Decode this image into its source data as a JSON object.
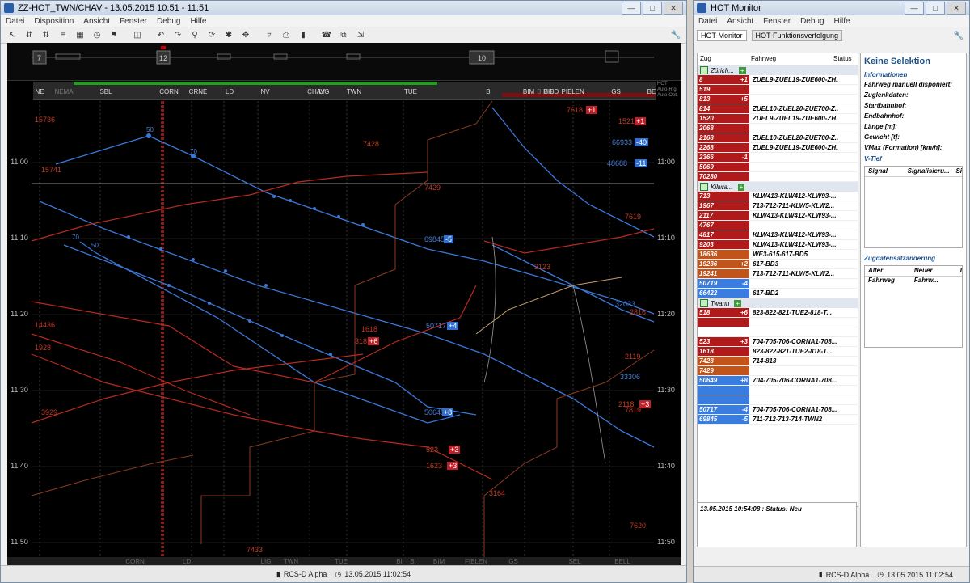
{
  "left_window": {
    "title": "ZZ-HOT_TWN/CHAV - 13.05.2015 10:51 - 11:51",
    "menu": [
      "Datei",
      "Disposition",
      "Ansicht",
      "Fenster",
      "Debug",
      "Hilfe"
    ],
    "overview_numbers": [
      "7",
      "12",
      "10"
    ],
    "stations_top": [
      "NE",
      "NEMA",
      "SBL",
      "CORN",
      "CRNE",
      "LD",
      "NV",
      "CHAV",
      "LIG",
      "TWN",
      "TUE",
      "BI",
      "BIMA",
      "BIM",
      "BIBD",
      "PIE",
      "LEN",
      "GS",
      "BE"
    ],
    "side_labels": [
      "HOT",
      "Auto-Rfg.",
      "Auto-Opt."
    ],
    "time_ticks": [
      "11:00",
      "11:10",
      "11:20",
      "11:30",
      "11:40",
      "11:50"
    ],
    "stations_bottom": [
      "CORN",
      "LD",
      "LIG",
      "TWN",
      "TUE",
      "BI",
      "BI",
      "BIM",
      "FIBLEN",
      "GS",
      "SEL",
      "BELL"
    ],
    "train_labels": [
      {
        "text": "15736",
        "color": "#c23b22"
      },
      {
        "text": "15741",
        "color": "#c23b22"
      },
      {
        "text": "7428",
        "color": "#c23b22"
      },
      {
        "text": "7429",
        "color": "#c23b22"
      },
      {
        "text": "7618",
        "color": "#c23b22"
      },
      {
        "text": "1521",
        "color": "#c23b22"
      },
      {
        "text": "66933",
        "color": "#4a7fd6"
      },
      {
        "text": "48688",
        "color": "#4a7fd6"
      },
      {
        "text": "7619",
        "color": "#c23b22"
      },
      {
        "text": "69845",
        "color": "#4a7fd6"
      },
      {
        "text": "3123",
        "color": "#c23b22"
      },
      {
        "text": "14436",
        "color": "#c23b22"
      },
      {
        "text": "1928",
        "color": "#c23b22"
      },
      {
        "text": "1618",
        "color": "#c23b22"
      },
      {
        "text": "318",
        "color": "#c23b22"
      },
      {
        "text": "50717",
        "color": "#4a7fd6"
      },
      {
        "text": "32033",
        "color": "#4a7fd6"
      },
      {
        "text": "2816",
        "color": "#c23b22"
      },
      {
        "text": "2119",
        "color": "#c23b22"
      },
      {
        "text": "33306",
        "color": "#4a7fd6"
      },
      {
        "text": "2118",
        "color": "#c23b22"
      },
      {
        "text": "7819",
        "color": "#c23b22"
      },
      {
        "text": "3929",
        "color": "#c23b22"
      },
      {
        "text": "50649",
        "color": "#4a7fd6"
      },
      {
        "text": "523",
        "color": "#c23b22"
      },
      {
        "text": "1623",
        "color": "#c23b22"
      },
      {
        "text": "3164",
        "color": "#c23b22"
      },
      {
        "text": "7620",
        "color": "#c23b22"
      },
      {
        "text": "7433",
        "color": "#c23b22"
      }
    ],
    "speed_labels": [
      "50",
      "70",
      "70",
      "50"
    ],
    "badges": [
      {
        "text": "+1",
        "color": "#c0202a"
      },
      {
        "text": "+1",
        "color": "#c0202a"
      },
      {
        "text": "-40",
        "color": "#2f6fd1"
      },
      {
        "text": "-11",
        "color": "#2f6fd1"
      },
      {
        "text": "-5",
        "color": "#2f6fd1"
      },
      {
        "text": "+6",
        "color": "#c0202a"
      },
      {
        "text": "+4",
        "color": "#2f6fd1"
      },
      {
        "text": "+3",
        "color": "#c0202a"
      },
      {
        "text": "+8",
        "color": "#2f6fd1"
      },
      {
        "text": "+3",
        "color": "#c0202a"
      },
      {
        "text": "+3",
        "color": "#c0202a"
      }
    ],
    "status": {
      "system": "RCS-D Alpha",
      "time": "13.05.2015 11:02:54"
    }
  },
  "right_window": {
    "title": "HOT Monitor",
    "menu": [
      "Datei",
      "Ansicht",
      "Fenster",
      "Debug",
      "Hilfe"
    ],
    "tabs": [
      "HOT-Monitor",
      "HOT-Funktionsverfolgung"
    ],
    "columns": {
      "zug": "Zug",
      "fahrweg": "Fahrweg",
      "status": "Status"
    },
    "groups": [
      {
        "name": "Zürich...",
        "rows": [
          {
            "zug": "8",
            "dev": "+1",
            "fahrweg": "ZUEL9-ZUEL19-ZUE600-ZH...",
            "color": "#b01a1a"
          },
          {
            "zug": "519",
            "dev": "",
            "fahrweg": "",
            "color": "#b01a1a"
          },
          {
            "zug": "813",
            "dev": "+5",
            "fahrweg": "",
            "color": "#b01a1a"
          },
          {
            "zug": "814",
            "dev": "",
            "fahrweg": "ZUEL10-ZUEL20-ZUE700-Z...",
            "color": "#b01a1a"
          },
          {
            "zug": "1520",
            "dev": "",
            "fahrweg": "ZUEL9-ZUEL19-ZUE600-ZH...",
            "color": "#b01a1a"
          },
          {
            "zug": "2068",
            "dev": "",
            "fahrweg": "",
            "color": "#b01a1a"
          },
          {
            "zug": "2168",
            "dev": "",
            "fahrweg": "ZUEL10-ZUEL20-ZUE700-Z...",
            "color": "#b01a1a"
          },
          {
            "zug": "2268",
            "dev": "",
            "fahrweg": "ZUEL9-ZUEL19-ZUE600-ZH...",
            "color": "#b01a1a"
          },
          {
            "zug": "2366",
            "dev": "-1",
            "fahrweg": "",
            "color": "#b01a1a"
          },
          {
            "zug": "5069",
            "dev": "",
            "fahrweg": "",
            "color": "#b01a1a"
          },
          {
            "zug": "70280",
            "dev": "",
            "fahrweg": "",
            "color": "#b01a1a"
          }
        ]
      },
      {
        "name": "Killwa...",
        "rows": [
          {
            "zug": "713",
            "dev": "",
            "fahrweg": "KLW413-KLW412-KLW93-...",
            "color": "#b01a1a"
          },
          {
            "zug": "1967",
            "dev": "",
            "fahrweg": "713-712-711-KLW5-KLW2...",
            "color": "#b01a1a"
          },
          {
            "zug": "2117",
            "dev": "",
            "fahrweg": "KLW413-KLW412-KLW93-...",
            "color": "#b01a1a"
          },
          {
            "zug": "4767",
            "dev": "",
            "fahrweg": "",
            "color": "#b01a1a"
          },
          {
            "zug": "4817",
            "dev": "",
            "fahrweg": "KLW413-KLW412-KLW93-...",
            "color": "#b01a1a"
          },
          {
            "zug": "9203",
            "dev": "",
            "fahrweg": "KLW413-KLW412-KLW93-...",
            "color": "#b01a1a"
          },
          {
            "zug": "18636",
            "dev": "",
            "fahrweg": "WE3-615-617-BD5",
            "color": "#c0541a"
          },
          {
            "zug": "19236",
            "dev": "+2",
            "fahrweg": "617-BD3",
            "color": "#c0541a"
          },
          {
            "zug": "19241",
            "dev": "",
            "fahrweg": "713-712-711-KLW5-KLW2...",
            "color": "#c0541a"
          },
          {
            "zug": "50719",
            "dev": "-4",
            "fahrweg": "",
            "color": "#3a7de0"
          },
          {
            "zug": "66422",
            "dev": "",
            "fahrweg": "617-BD2",
            "color": "#3a7de0"
          }
        ]
      },
      {
        "name": "Twann",
        "rows": [
          {
            "zug": "518",
            "dev": "+6",
            "fahrweg": "823-822-821-TUE2-818-T...",
            "color": "#b01a1a"
          },
          {
            "zug": "",
            "dev": "",
            "fahrweg": "",
            "color": "#b01a1a"
          },
          {
            "zug": "",
            "dev": "",
            "fahrweg": "",
            "color": "#ffffff"
          },
          {
            "zug": "523",
            "dev": "+3",
            "fahrweg": "704-705-706-CORNA1-708...",
            "color": "#b01a1a"
          },
          {
            "zug": "1618",
            "dev": "",
            "fahrweg": "823-822-821-TUE2-818-T...",
            "color": "#b01a1a"
          },
          {
            "zug": "7428",
            "dev": "",
            "fahrweg": "714-813",
            "color": "#c0541a"
          },
          {
            "zug": "7429",
            "dev": "",
            "fahrweg": "",
            "color": "#c0541a"
          },
          {
            "zug": "50649",
            "dev": "+8",
            "fahrweg": "704-705-706-CORNA1-708...",
            "color": "#3a7de0"
          },
          {
            "zug": "",
            "dev": "",
            "fahrweg": "",
            "color": "#3a7de0"
          },
          {
            "zug": "",
            "dev": "",
            "fahrweg": "",
            "color": "#3a7de0"
          },
          {
            "zug": "50717",
            "dev": "-4",
            "fahrweg": "704-705-706-CORNA1-708...",
            "color": "#3a7de0"
          },
          {
            "zug": "69845",
            "dev": "-5",
            "fahrweg": "711-712-713-714-TWN2",
            "color": "#3a7de0"
          }
        ]
      }
    ],
    "detail": {
      "title": "Keine Selektion",
      "info_header": "Informationen",
      "fields": [
        "Fahrweg manuell disponiert:",
        "Zuglenkdaten:",
        "Startbahnhof:",
        "Endbahnhof:",
        "Länge [m]:",
        "Gewicht [t]:",
        "VMax (Formation) [km/h]:"
      ],
      "vtief_header": "V-Tief",
      "vtief_cols": [
        "Signal",
        "Signalisieru...",
        "Si"
      ],
      "change_header": "Zugdatensatzänderung",
      "change_cols": [
        "Alter Fahrweg",
        "Neuer Fahrw...",
        "I"
      ]
    },
    "message": "13.05.2015 10:54:08 : Status: Neu",
    "status": {
      "system": "RCS-D Alpha",
      "time": "13.05.2015 11:02:54"
    }
  }
}
